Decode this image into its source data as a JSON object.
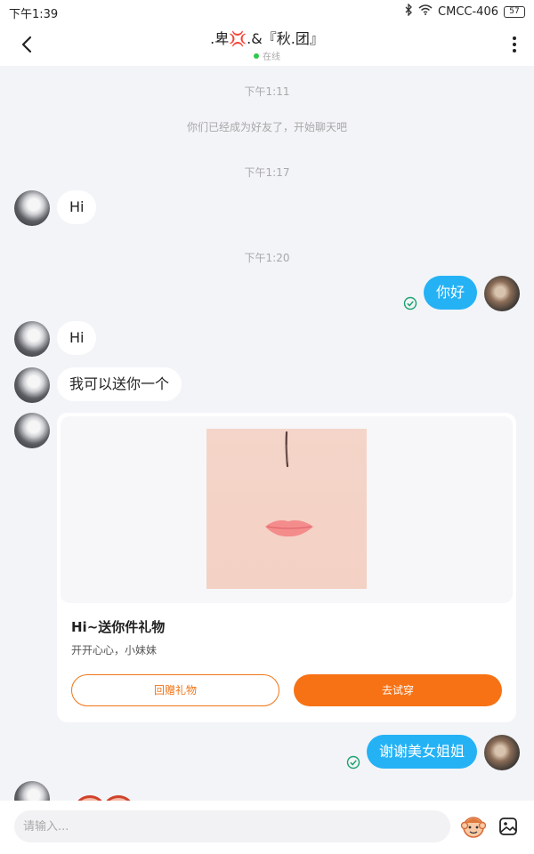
{
  "status_bar": {
    "time": "下午1:39",
    "network": "CMCC-406",
    "battery": "57"
  },
  "header": {
    "title": ".卑💢.&『秋.团』",
    "status": "在线"
  },
  "messages": {
    "time1": "下午1:11",
    "friend_notice": "你们已经成为好友了，开始聊天吧",
    "time2": "下午1:17",
    "msg1": "Hi",
    "time3": "下午1:20",
    "msg2": "你好",
    "msg3": "Hi",
    "msg4": "我可以送你一个",
    "msg5": "谢谢美女姐姐"
  },
  "gift_card": {
    "title": "Hi~送你件礼物",
    "subtitle": "开开心心，小妹妹",
    "return_gift_label": "回赠礼物",
    "try_on_label": "去试穿"
  },
  "input_bar": {
    "placeholder": "请输入..."
  },
  "colors": {
    "accent_blue": "#24b2f5",
    "accent_orange": "#f77214",
    "read_green": "#1aa36f",
    "online_green": "#2ec84d"
  },
  "icons": [
    "back-icon",
    "bluetooth-icon",
    "wifi-icon",
    "more-icon",
    "read-check-icon",
    "emoji-icon",
    "image-icon"
  ]
}
